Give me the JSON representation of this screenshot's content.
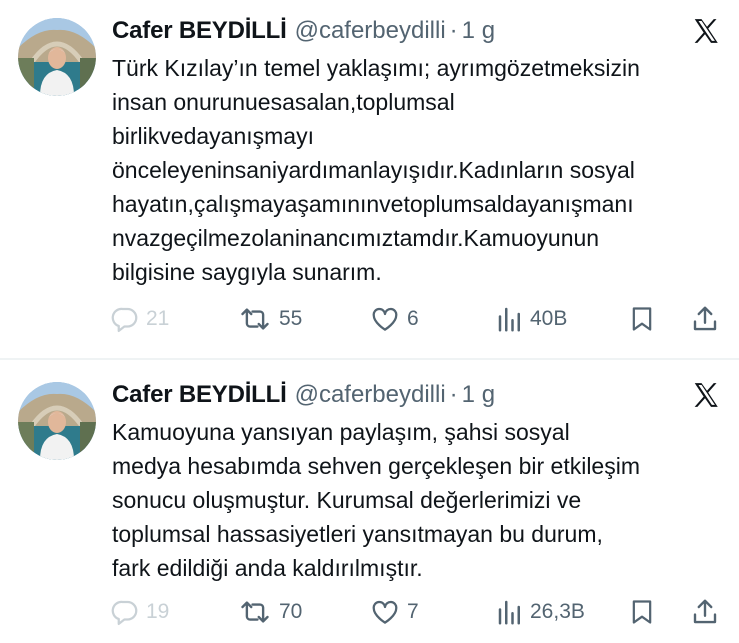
{
  "tweets": [
    {
      "display_name": "Cafer BEYDİLLİ",
      "handle": "@caferbeydilli",
      "separator": "·",
      "time": "1 g",
      "text_lines": [
        "Türk Kızılay’ın temel yaklaşımı; ayrımgözetmeksizin",
        "insan onurunuesasalan,toplumsal",
        "birlikvedayanışmayı",
        "önceleyeninsaniyardımanlayışıdır.Kadınların sosyal",
        "hayatın,çalışmayaşamınınvetoplumsaldayanışmanı",
        "nvazgeçilmezolaninancımıztamdır.Kamuoyunun",
        "bilgisine saygıyla sunarım."
      ],
      "replies": "21",
      "reposts": "55",
      "likes": "6",
      "views": "40B"
    },
    {
      "display_name": "Cafer BEYDİLLİ",
      "handle": "@caferbeydilli",
      "separator": "·",
      "time": "1 g",
      "text_lines": [
        "Kamuoyuna yansıyan paylaşım, şahsi sosyal",
        "medya hesabımda sehven gerçekleşen bir etkileşim",
        "sonucu oluşmuştur. Kurumsal değerlerimizi ve",
        "toplumsal hassasiyetleri yansıtmayan bu durum,",
        "fark edildiği anda kaldırılmıştır."
      ],
      "replies": "19",
      "reposts": "70",
      "likes": "7",
      "views": "26,3B"
    }
  ],
  "icons": {
    "reply": "reply-icon",
    "repost": "repost-icon",
    "like": "like-icon",
    "views": "views-icon",
    "bookmark": "bookmark-icon",
    "share": "share-icon",
    "brand": "x-logo-icon"
  },
  "colors": {
    "text": "#0f1419",
    "secondary": "#536471",
    "faded": "#c9d1d6",
    "divider": "#eff3f4"
  }
}
